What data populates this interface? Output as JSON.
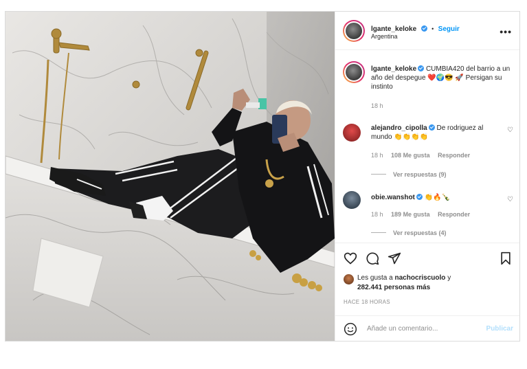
{
  "post": {
    "username": "lgante_keloke",
    "location": "Argentina",
    "follow_label": "Seguir",
    "more_label": "•••",
    "caption_text": "CUMBIA420 del barrio a un año del despegue ❤️🌍😎 🚀 Persigan su instinto",
    "caption_time": "18 h"
  },
  "comments": [
    {
      "username": "alejandro_cipolla",
      "text": "De rodriguez al mundo 👏👏👏👏",
      "time": "18 h",
      "likes": "108 Me gusta",
      "reply_label": "Responder",
      "view_replies": "Ver respuestas (9)"
    },
    {
      "username": "obie.wanshot",
      "text": "👏🔥🍾",
      "time": "18 h",
      "likes": "189 Me gusta",
      "reply_label": "Responder",
      "view_replies": "Ver respuestas (4)"
    }
  ],
  "likes": {
    "prefix": "Les gusta a",
    "user": "nachocriscuolo",
    "connector": "y",
    "count": "282.441 personas más"
  },
  "timestamp": "HACE 18 HORAS",
  "composer": {
    "placeholder": "Añade un comentario...",
    "publish_label": "Publicar"
  },
  "colors": {
    "accent": "#0095f6",
    "verified": "#3897f0",
    "publish_disabled": "#b2dffc"
  },
  "icons": [
    "heart-icon",
    "comment-icon",
    "share-icon",
    "bookmark-icon",
    "emoji-icon",
    "more-icon",
    "verified-icon"
  ]
}
